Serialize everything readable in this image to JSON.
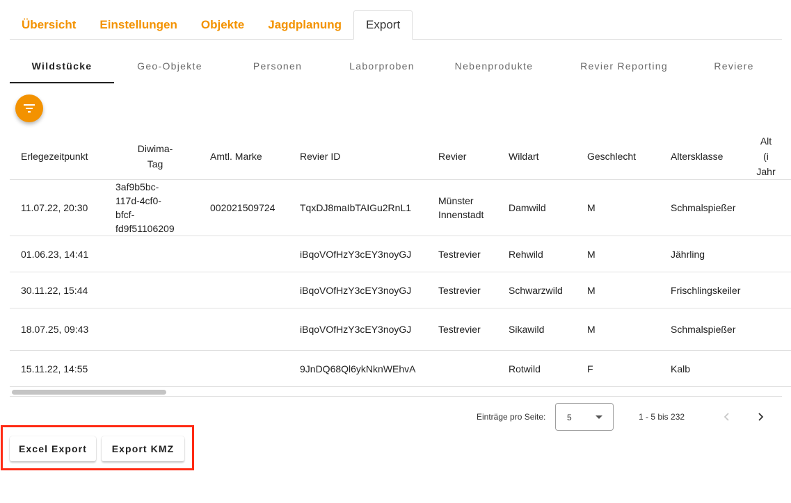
{
  "top_tabs": [
    "Übersicht",
    "Einstellungen",
    "Objekte",
    "Jagdplanung",
    "Export"
  ],
  "sub_tabs": [
    "Wildstücke",
    "Geo-Objekte",
    "Personen",
    "Laborproben",
    "Nebenprodukte",
    "Revier Reporting",
    "Reviere"
  ],
  "filter_icon": "filter-list-icon",
  "table": {
    "headers": {
      "erlegezeitpunkt": "Erlegezeitpunkt",
      "diwima_1": "Diwima-",
      "diwima_2": "Tag",
      "amtl_marke": "Amtl. Marke",
      "revier_id": "Revier ID",
      "revier": "Revier",
      "wildart": "Wildart",
      "geschlecht": "Geschlecht",
      "altersklasse": "Altersklasse",
      "alter_1": "Alt",
      "alter_2": "(i",
      "alter_3": "Jahr"
    },
    "rows": [
      {
        "erlegezeitpunkt": "11.07.22, 20:30",
        "diwima": [
          "3af9b5bc-",
          "117d-4cf0-",
          "bfcf-",
          "fd9f51106209"
        ],
        "amtl_marke": "002021509724",
        "revier_id": "TqxDJ8maIbTAIGu2RnL1",
        "revier": [
          "Münster",
          "Innenstadt"
        ],
        "wildart": "Damwild",
        "geschlecht": "M",
        "altersklasse": "Schmalspießer"
      },
      {
        "erlegezeitpunkt": "01.06.23, 14:41",
        "revier_id": "iBqoVOfHzY3cEY3noyGJ",
        "revier": [
          "Testrevier"
        ],
        "wildart": "Rehwild",
        "geschlecht": "M",
        "altersklasse": "Jährling"
      },
      {
        "erlegezeitpunkt": "30.11.22, 15:44",
        "revier_id": "iBqoVOfHzY3cEY3noyGJ",
        "revier": [
          "Testrevier"
        ],
        "wildart": "Schwarzwild",
        "geschlecht": "M",
        "altersklasse": "Frischlingskeiler"
      },
      {
        "erlegezeitpunkt": "18.07.25, 09:43",
        "revier_id": "iBqoVOfHzY3cEY3noyGJ",
        "revier": [
          "Testrevier"
        ],
        "wildart": "Sikawild",
        "geschlecht": "M",
        "altersklasse": "Schmalspießer"
      },
      {
        "erlegezeitpunkt": "15.11.22, 14:55",
        "revier_id": "9JnDQ68Ql6ykNknWEhvA",
        "wildart": "Rotwild",
        "geschlecht": "F",
        "altersklasse": "Kalb"
      }
    ]
  },
  "paginator": {
    "label": "Einträge pro Seite:",
    "page_size": "5",
    "range": "1 - 5 bis 232"
  },
  "actions": {
    "excel_export": "Excel Export",
    "export_kmz": "Export KMZ"
  },
  "colors": {
    "accent": "#f39200",
    "highlight_box": "#ff2a13"
  }
}
